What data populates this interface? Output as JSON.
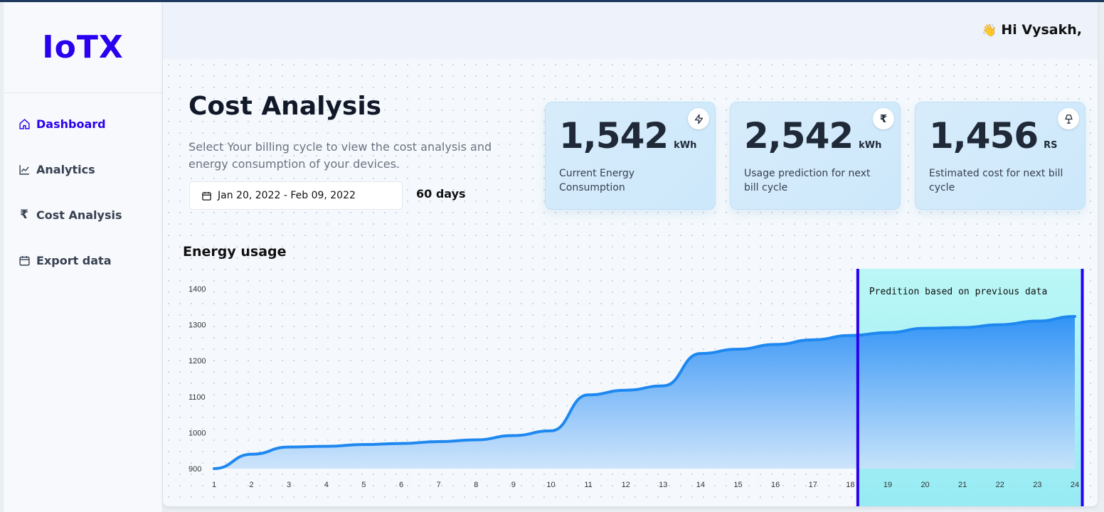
{
  "app": {
    "logo": "IoTX"
  },
  "header": {
    "greeting_icon": "waving-hand-icon",
    "greeting": "Hi Vysakh,"
  },
  "sidebar": {
    "items": [
      {
        "label": "Dashboard",
        "icon": "home-icon",
        "active": true
      },
      {
        "label": "Analytics",
        "icon": "line-chart-icon"
      },
      {
        "label": "Cost Analysis",
        "icon": "rupee-icon"
      },
      {
        "label": "Export data",
        "icon": "calendar-icon"
      }
    ]
  },
  "page": {
    "title": "Cost Analysis",
    "subtitle": "Select Your billing cycle to view the cost analysis and energy consumption of your devices.",
    "date_range": "Jan 20, 2022 - Feb 09, 2022",
    "days": "60 days"
  },
  "stats": [
    {
      "value": "1,542",
      "unit": "kWh",
      "label": "Current Energy Consumption",
      "icon": "lightning-icon"
    },
    {
      "value": "2,542",
      "unit": "kWh",
      "label": "Usage prediction for next bill cycle",
      "icon": "rupee-icon"
    },
    {
      "value": "1,456",
      "unit": "RS",
      "label": "Estimated cost for next bill cycle",
      "icon": "lamp-icon"
    }
  ],
  "chart_section": {
    "title": "Energy usage"
  },
  "colors": {
    "accent": "#2a00f0",
    "line": "#1e88f0",
    "prediction_border": "#2a00f0",
    "prediction_fill": "#9ef4f4"
  },
  "chart_data": {
    "type": "area",
    "x": [
      1,
      2,
      3,
      4,
      5,
      6,
      7,
      8,
      9,
      10,
      11,
      12,
      13,
      14,
      15,
      16,
      17,
      18,
      19,
      20,
      21,
      22,
      23,
      24
    ],
    "values": [
      900,
      940,
      960,
      962,
      967,
      970,
      975,
      980,
      992,
      1005,
      1105,
      1118,
      1130,
      1220,
      1232,
      1245,
      1258,
      1270,
      1278,
      1290,
      1292,
      1300,
      1310,
      1323
    ],
    "ylim": [
      900,
      1400
    ],
    "yticks": [
      900,
      1000,
      1100,
      1200,
      1300,
      1400
    ],
    "prediction": {
      "from": 18.2,
      "to": 24.2,
      "label": "Predition based on previous data"
    },
    "grid": false
  }
}
